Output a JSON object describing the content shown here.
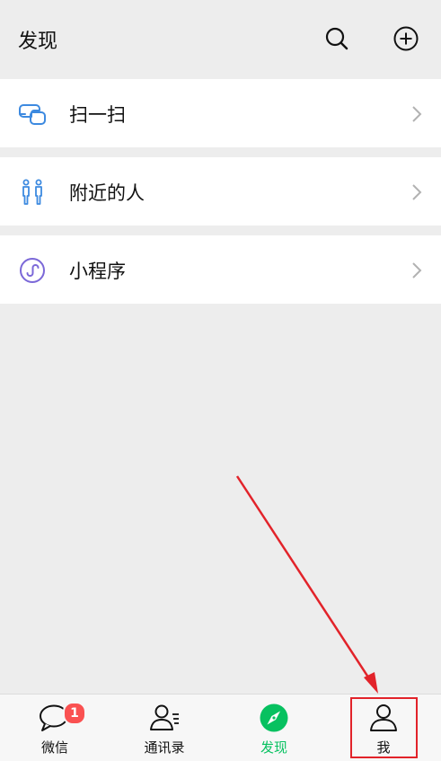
{
  "header": {
    "title": "发现",
    "search_icon": "search-icon",
    "add_icon": "add-circle-icon"
  },
  "menu_groups": [
    {
      "items": [
        {
          "label": "扫一扫",
          "icon": "scan-icon",
          "color": "#3d8ae0"
        }
      ]
    },
    {
      "items": [
        {
          "label": "附近的人",
          "icon": "nearby-people-icon",
          "color": "#3d8ae0"
        }
      ]
    },
    {
      "items": [
        {
          "label": "小程序",
          "icon": "mini-program-icon",
          "color": "#7b68d8"
        }
      ]
    }
  ],
  "tabbar": {
    "tabs": [
      {
        "label": "微信",
        "icon": "chat-bubble-icon",
        "badge": "1",
        "active": false
      },
      {
        "label": "通讯录",
        "icon": "contacts-icon",
        "active": false
      },
      {
        "label": "发现",
        "icon": "compass-icon",
        "active": true
      },
      {
        "label": "我",
        "icon": "profile-icon",
        "active": false
      }
    ]
  },
  "colors": {
    "accent_green": "#07c160",
    "badge_red": "#fa5151",
    "annotation_red": "#e2232a"
  }
}
